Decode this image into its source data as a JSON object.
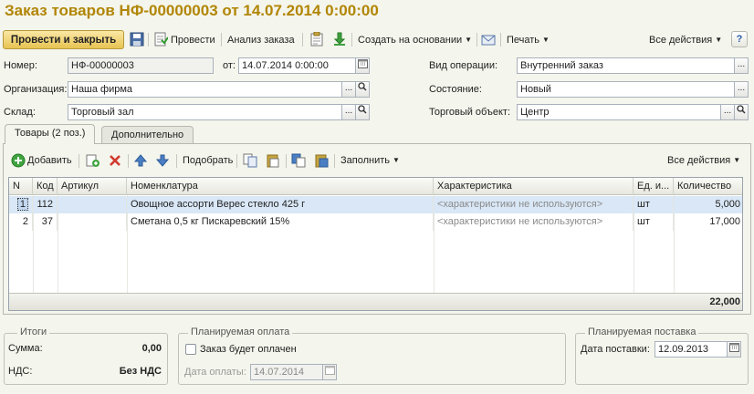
{
  "title": "Заказ товаров НФ-00000003 от 14.07.2014 0:00:00",
  "toolbar": {
    "post_close": "Провести и закрыть",
    "post": "Провести",
    "analysis": "Анализ заказа",
    "create_based": "Создать на основании",
    "print": "Печать",
    "all_actions": "Все действия",
    "help": "?"
  },
  "header": {
    "number_label": "Номер:",
    "number_value": "НФ-00000003",
    "date_label": "от:",
    "date_value": "14.07.2014  0:00:00",
    "org_label": "Организация:",
    "org_value": "Наша фирма",
    "warehouse_label": "Склад:",
    "warehouse_value": "Торговый зал",
    "operation_label": "Вид операции:",
    "operation_value": "Внутренний заказ",
    "state_label": "Состояние:",
    "state_value": "Новый",
    "trade_object_label": "Торговый объект:",
    "trade_object_value": "Центр"
  },
  "tabs": [
    {
      "label": "Товары (2 поз.)",
      "active": true
    },
    {
      "label": "Дополнительно",
      "active": false
    }
  ],
  "table_toolbar": {
    "add": "Добавить",
    "pick": "Подобрать",
    "fill": "Заполнить",
    "all_actions": "Все действия"
  },
  "table": {
    "columns": [
      "N",
      "Код",
      "Артикул",
      "Номенклатура",
      "Характеристика",
      "Ед. и...",
      "Количество"
    ],
    "rows": [
      {
        "n": "1",
        "code": "112",
        "article": "",
        "name": "Овощное ассорти Верес стекло 425 г",
        "char": "<характеристики не используются>",
        "unit": "шт",
        "qty": "5,000"
      },
      {
        "n": "2",
        "code": "37",
        "article": "",
        "name": "Сметана 0,5 кг  Пискаревский 15%",
        "char": "<характеристики не используются>",
        "unit": "шт",
        "qty": "17,000"
      }
    ],
    "total_qty": "22,000"
  },
  "totals": {
    "legend": "Итоги",
    "sum_label": "Сумма:",
    "sum_value": "0,00",
    "vat_label": "НДС:",
    "vat_value": "Без НДС"
  },
  "payment": {
    "legend": "Планируемая оплата",
    "checkbox_label": "Заказ будет оплачен",
    "date_label": "Дата оплаты:",
    "date_value": "14.07.2014"
  },
  "delivery": {
    "legend": "Планируемая поставка",
    "date_label": "Дата поставки:",
    "date_value": "12.09.2013"
  },
  "colors": {
    "title": "#b18505",
    "primary_button": "#e7c352",
    "selected_row": "#d9e7f6"
  }
}
